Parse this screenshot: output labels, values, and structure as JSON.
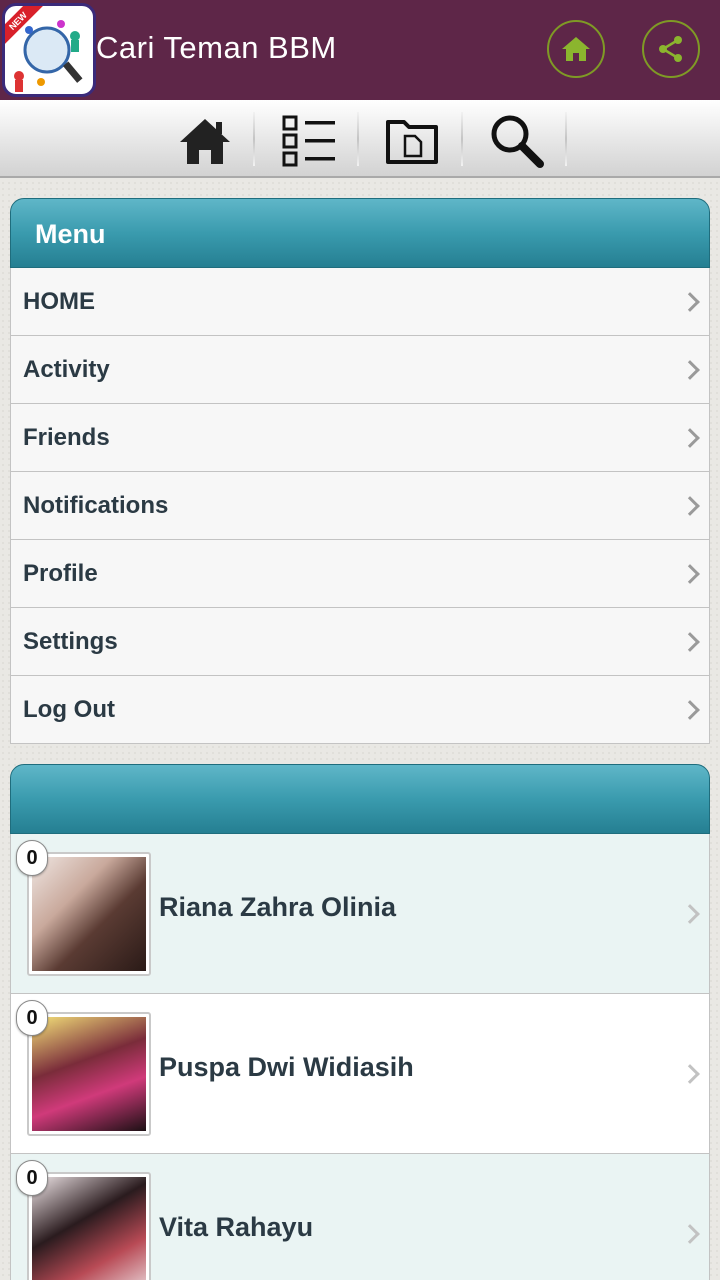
{
  "app": {
    "title": "Cari Teman BBM",
    "icon_badge": "NEW"
  },
  "actions": {
    "home_icon": "home-icon",
    "share_icon": "share-icon",
    "accent_color": "#7f9a25"
  },
  "toolbar": {
    "items": [
      {
        "icon": "home-icon"
      },
      {
        "icon": "list-icon"
      },
      {
        "icon": "folder-icon"
      },
      {
        "icon": "search-icon"
      }
    ]
  },
  "menu": {
    "header": "Menu",
    "items": [
      {
        "label": "HOME"
      },
      {
        "label": "Activity"
      },
      {
        "label": "Friends"
      },
      {
        "label": "Notifications"
      },
      {
        "label": "Profile"
      },
      {
        "label": "Settings"
      },
      {
        "label": "Log Out"
      }
    ]
  },
  "friends": {
    "header": "",
    "items": [
      {
        "name": "Riana Zahra Olinia",
        "count": "0"
      },
      {
        "name": "Puspa Dwi Widiasih",
        "count": "0"
      },
      {
        "name": "Vita Rahayu",
        "count": "0"
      }
    ]
  },
  "colors": {
    "appbar": "#5e2648",
    "panel_header": "#3a9bae"
  }
}
